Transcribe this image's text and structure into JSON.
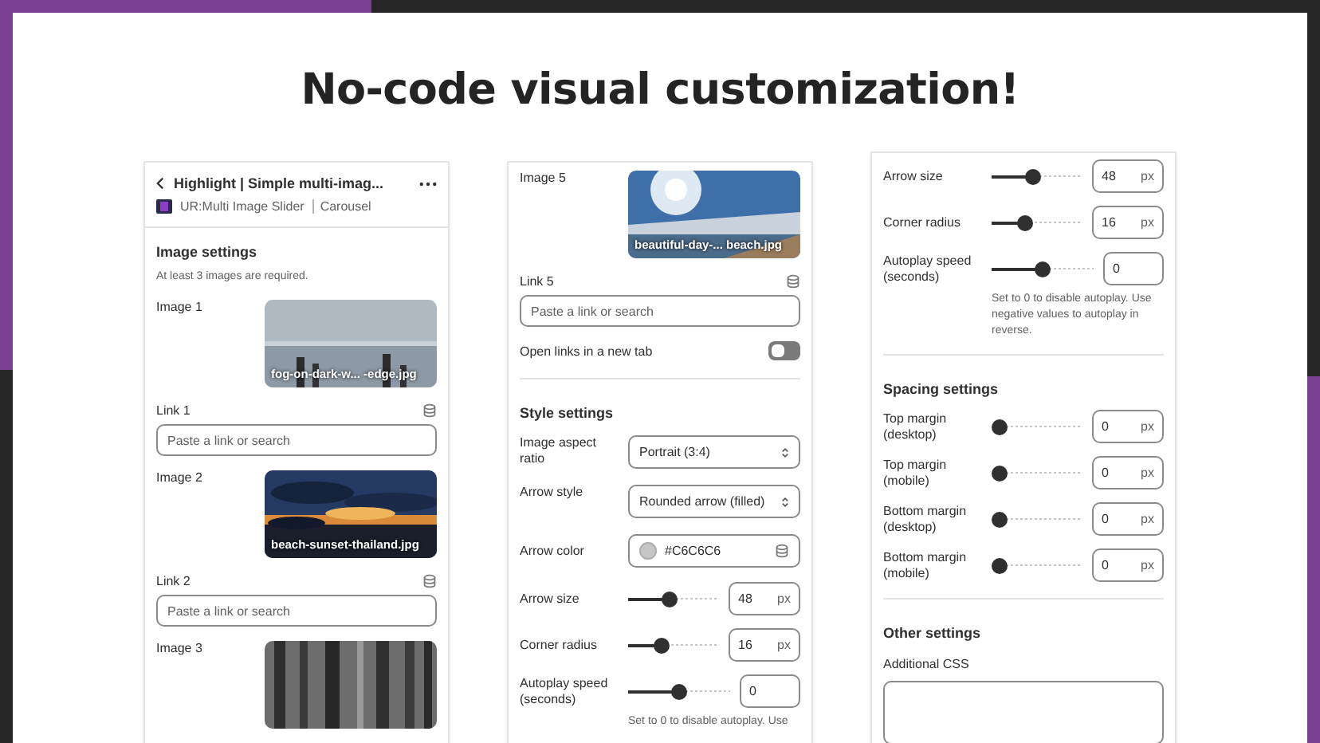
{
  "heading": "No-code visual customization!",
  "panels": [
    {
      "rows": [
        {
          "kind": "header",
          "title": "Highlight | Simple multi-imag...",
          "app": "UR:Multi Image Slider",
          "type": "Carousel"
        },
        {
          "kind": "section",
          "label": "Image settings"
        },
        {
          "kind": "note",
          "text": "At least 3 images are required."
        },
        {
          "label": "Image 1",
          "caption": "fog-on-dark-w... -edge.jpg"
        },
        {
          "kind": "link",
          "label": "Link 1",
          "placeholder": "Paste a link or search"
        },
        {
          "label": "Image 2",
          "caption": "beach-sunset-thailand.jpg"
        },
        {
          "kind": "link",
          "label": "Link 2",
          "placeholder": "Paste a link or search"
        },
        {
          "label": "Image 3"
        }
      ]
    },
    {
      "rows": [
        {
          "label": "Image 5",
          "caption": "beautiful-day-... beach.jpg"
        },
        {
          "kind": "link",
          "label": "Link 5",
          "placeholder": "Paste a link or search"
        },
        {
          "kind": "toggle",
          "label": "Open links in a new tab",
          "on": false
        },
        {
          "kind": "divider"
        },
        {
          "kind": "section",
          "label": "Style settings"
        },
        {
          "kind": "select",
          "label": "Image aspect ratio",
          "value": "Portrait (3:4)"
        },
        {
          "kind": "select",
          "label": "Arrow style",
          "value": "Rounded arrow (filled)"
        },
        {
          "kind": "color",
          "label": "Arrow color",
          "value": "#C6C6C6"
        },
        {
          "kind": "slider",
          "label": "Arrow size",
          "level": 0.45,
          "value": "48",
          "unit": "px"
        },
        {
          "kind": "slider",
          "label": "Corner radius",
          "level": 0.35,
          "value": "16",
          "unit": "px"
        },
        {
          "kind": "slider",
          "label": "Autoplay speed (seconds)",
          "level": 0.5,
          "value": "0",
          "note": "Set to 0 to disable autoplay. Use"
        }
      ]
    },
    {
      "rows": [
        {
          "kind": "slider",
          "label": "Arrow size",
          "level": 0.45,
          "value": "48",
          "unit": "px"
        },
        {
          "kind": "slider",
          "label": "Corner radius",
          "level": 0.35,
          "value": "16",
          "unit": "px"
        },
        {
          "kind": "slider",
          "label": "Autoplay speed (seconds)",
          "level": 0.5,
          "value": "0",
          "note": "Set to 0 to disable autoplay. Use negative values to autoplay in reverse."
        },
        {
          "kind": "divider"
        },
        {
          "kind": "section",
          "label": "Spacing settings"
        },
        {
          "kind": "slider",
          "label": "Top margin (desktop)",
          "level": 0,
          "value": "0",
          "unit": "px"
        },
        {
          "kind": "slider",
          "label": "Top margin (mobile)",
          "level": 0,
          "value": "0",
          "unit": "px"
        },
        {
          "kind": "slider",
          "label": "Bottom margin (desktop)",
          "level": 0,
          "value": "0",
          "unit": "px"
        },
        {
          "kind": "slider",
          "label": "Bottom margin (mobile)",
          "level": 0,
          "value": "0",
          "unit": "px"
        },
        {
          "kind": "divider"
        },
        {
          "kind": "section",
          "label": "Other settings"
        },
        {
          "kind": "textarea",
          "label": "Additional CSS"
        }
      ]
    }
  ]
}
